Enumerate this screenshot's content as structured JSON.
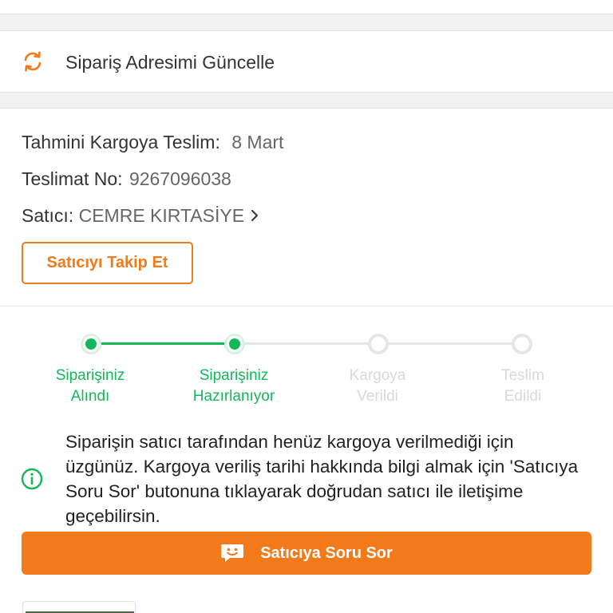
{
  "address": {
    "update_label": "Sipariş Adresimi Güncelle",
    "icon": "refresh-icon"
  },
  "shipment": {
    "estimated_label": "Tahmini Kargoya Teslim:",
    "estimated_value": "8 Mart",
    "delivery_no_label": "Teslimat No:",
    "delivery_no_value": "9267096038",
    "seller_label": "Satıcı:",
    "seller_value": "CEMRE KIRTASİYE",
    "follow_button": "Satıcıyı Takip Et"
  },
  "progress": {
    "steps": [
      {
        "line1": "Siparişiniz",
        "line2": "Alındı",
        "state": "done"
      },
      {
        "line1": "Siparişiniz",
        "line2": "Hazırlanıyor",
        "state": "done"
      },
      {
        "line1": "Kargoya",
        "line2": "Verildi",
        "state": "pending"
      },
      {
        "line1": "Teslim",
        "line2": "Edildi",
        "state": "pending"
      }
    ]
  },
  "notice": {
    "text": "Siparişin satıcı tarafından henüz kargoya verilmediği için üzgünüz. Kargoya veriliş tarihi hakkında bilgi almak için 'Satıcıya Soru Sor' butonuna tıklayarak doğrudan satıcı ile iletişime geçebilirsin.",
    "icon": "info-icon"
  },
  "ask_button": {
    "label": "Satıcıya Soru Sor",
    "icon": "chat-smile-icon"
  },
  "colors": {
    "accent": "#f27a1a",
    "success": "#14b85a",
    "pending": "#e6e6e6"
  }
}
